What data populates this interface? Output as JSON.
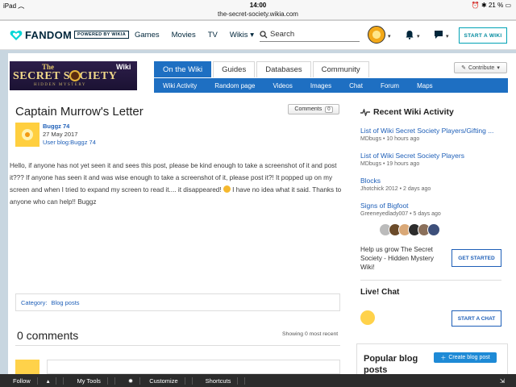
{
  "ios": {
    "device": "iPad",
    "time": "14:00",
    "url": "the-secret-society.wikia.com",
    "battery": "21 %"
  },
  "fandom": {
    "logo_text": "FANDOM",
    "powered_by": "POWERED BY WIKIA",
    "nav": [
      "Games",
      "Movies",
      "TV",
      "Wikis"
    ],
    "search_placeholder": "Search",
    "start_wiki": "START A WIKI"
  },
  "wiki": {
    "wordmark": {
      "line1": "The",
      "line2": "SECRET  SOCIETY",
      "line3": "HIDDEN MYSTERY",
      "wiki": "Wiki"
    },
    "tabs": [
      "On the Wiki",
      "Guides",
      "Databases",
      "Community"
    ],
    "subnav": [
      "Wiki Activity",
      "Random page",
      "Videos",
      "Images",
      "Chat",
      "Forum",
      "Maps"
    ],
    "contribute": "Contribute"
  },
  "article": {
    "title": "Captain Murrow's Letter",
    "comments_label": "Comments",
    "comments_count": "0",
    "author_name": "Buggz 74",
    "date": "27 May 2017",
    "user_blog": "User blog:Buggz 74",
    "body_1": "Hello, if anyone has not yet seen it and sees this post, please be kind enough to take a screenshot of it and post it??? If anyone has seen it and was wise enough to take a screenshot of it, please post it?! It popped up on my screen and when I tried to expand my screen to read it.... it disappeared!",
    "body_2": " I have no idea what it said. Thanks to anyone who can help!! Buggz",
    "category_label": "Category:",
    "category_value": "Blog posts",
    "zero_comments": "0 comments",
    "showing": "Showing 0 most recent"
  },
  "rail": {
    "activity_title": "Recent Wiki Activity",
    "activity": [
      {
        "title": "List of Wiki Secret Society Players/Gifting ...",
        "meta": "MDbugs • 10 hours ago"
      },
      {
        "title": "List of Wiki Secret Society Players",
        "meta": "MDbugs • 19 hours ago"
      },
      {
        "title": "Blocks",
        "meta": "Jhotchick 2012 • 2 days ago"
      },
      {
        "title": "Signs of Bigfoot",
        "meta": "Greeneyedlady007 • 5 days ago"
      }
    ],
    "grow_text": "Help us grow The Secret Society - Hidden Mystery Wiki!",
    "get_started": "GET STARTED",
    "live_chat": "Live! Chat",
    "start_chat": "START A CHAT",
    "popular": "Popular blog posts",
    "create_blog": "Create blog post"
  },
  "toolbar": {
    "follow": "Follow",
    "my_tools": "My Tools",
    "customize": "Customize",
    "shortcuts": "Shortcuts"
  }
}
